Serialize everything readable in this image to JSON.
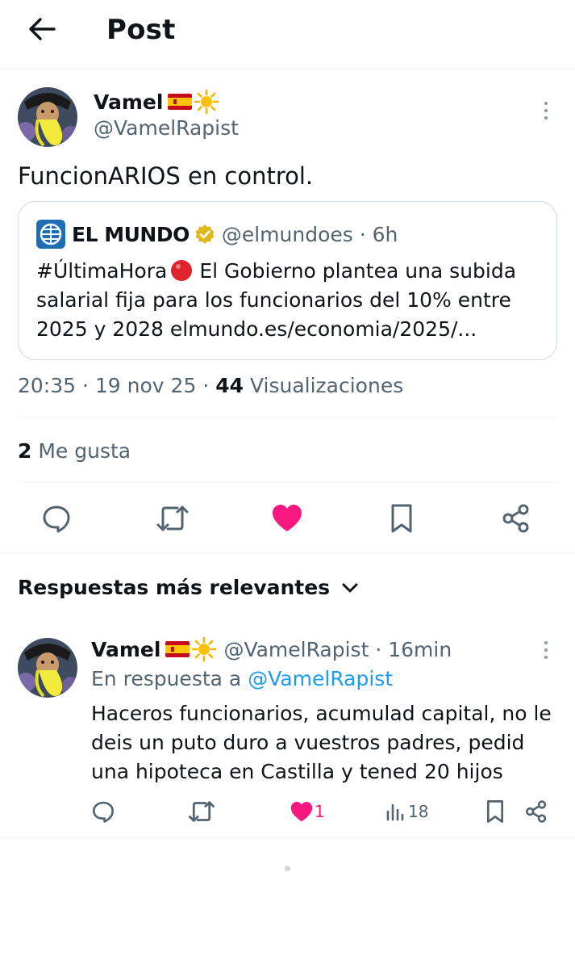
{
  "header": {
    "title": "Post",
    "back_icon": "arrow-left-icon"
  },
  "post": {
    "author_name": "Vamel",
    "author_handle": "@VamelRapist",
    "name_emojis": [
      "spain-flag-emoji",
      "sun-emoji"
    ],
    "text": "FuncionARIOS en control.",
    "quote": {
      "source_name": "EL MUNDO",
      "source_handle": "@elmundoes",
      "source_time": "6h",
      "verified_color": "#e2b719",
      "text_lines": [
        "#ÚltimaHora",
        "El Gobierno plantea una subida",
        "salarial fija para los funcionarios del 10% entre",
        "2025 y 2028 elmundo.es/economia/2025/..."
      ]
    },
    "time": "20:35",
    "date": "19 nov 25",
    "views_count": "44",
    "views_label": "Visualizaciones",
    "likes_count": "2",
    "likes_label": "Me gusta",
    "actions": [
      "reply-icon",
      "retweet-icon",
      "like-icon",
      "bookmark-icon",
      "share-icon"
    ],
    "like_color": "#f91880"
  },
  "replies_section": {
    "title": "Respuestas más relevantes"
  },
  "reply": {
    "author_name": "Vamel",
    "author_handle": "@VamelRapist",
    "time": "16min",
    "in_reply_prefix": "En respuesta a",
    "in_reply_mention": "@VamelRapist",
    "text_lines": [
      "Haceros funcionarios, acumulad capital, no le",
      "deis un puto duro a vuestros padres, pedid",
      "una hipoteca en Castilla y tened 20 hijos"
    ],
    "like_count": "1",
    "views_count": "18"
  },
  "colors": {
    "text": "#0f1419",
    "secondary": "#536471",
    "accent": "#1d9bf0",
    "border": "#cfd9de"
  }
}
